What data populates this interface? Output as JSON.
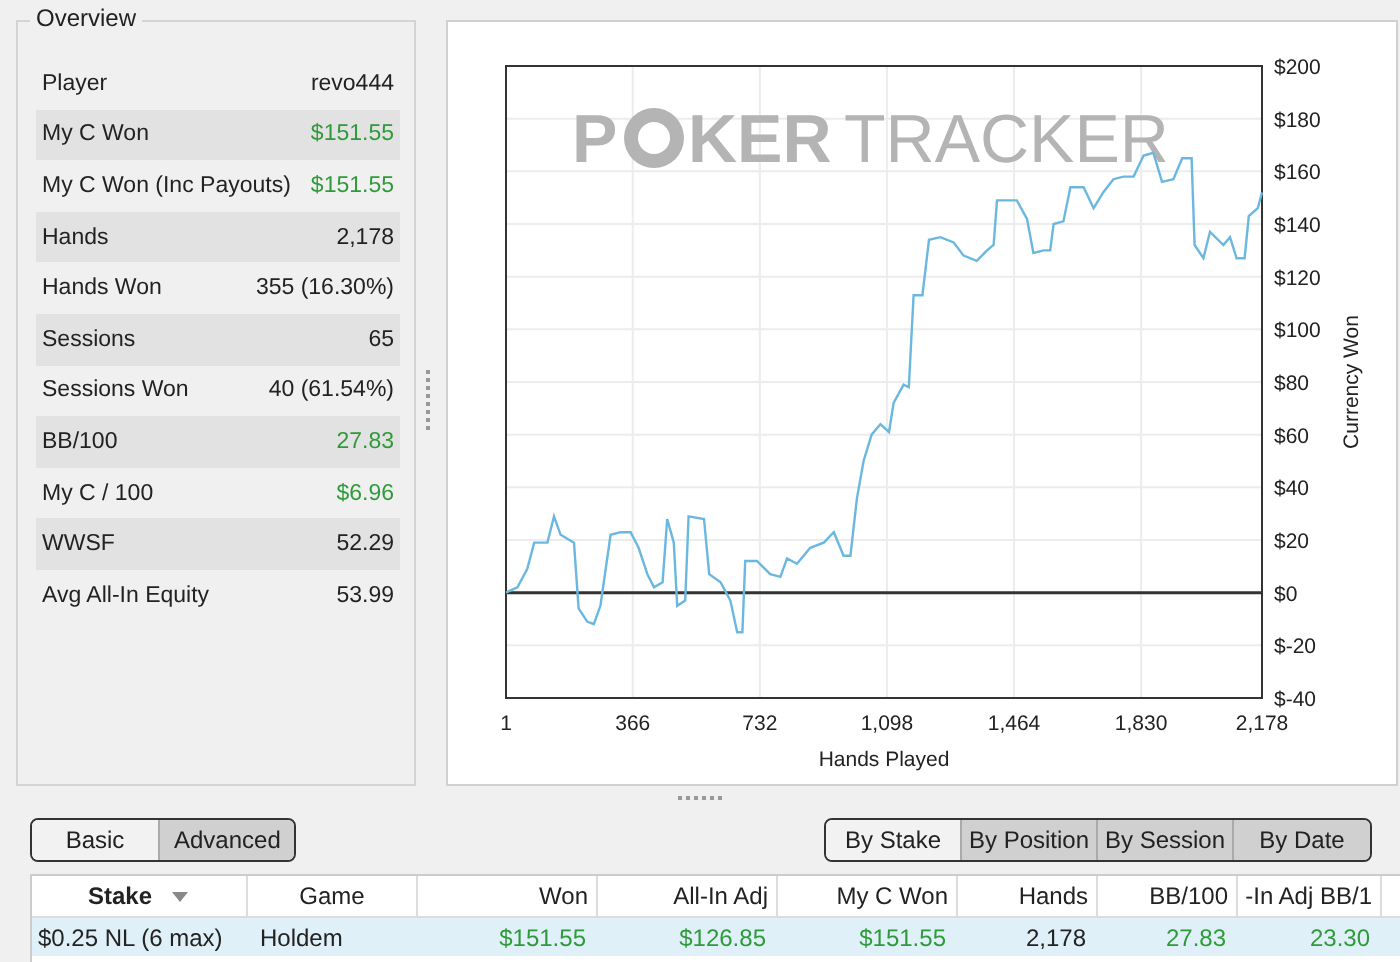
{
  "overview": {
    "title": "Overview",
    "rows": [
      {
        "label": "Player",
        "value": "revo444",
        "kind": "plain"
      },
      {
        "label": "My C Won",
        "value": "$151.55",
        "kind": "gain"
      },
      {
        "label": "My C Won (Inc Payouts)",
        "value": "$151.55",
        "kind": "gain"
      },
      {
        "label": "Hands",
        "value": "2,178",
        "kind": "plain"
      },
      {
        "label": "Hands Won",
        "value": "355 (16.30%)",
        "kind": "plain"
      },
      {
        "label": "Sessions",
        "value": "65",
        "kind": "plain"
      },
      {
        "label": "Sessions Won",
        "value": "40 (61.54%)",
        "kind": "plain"
      },
      {
        "label": "BB/100",
        "value": "27.83",
        "kind": "gain"
      },
      {
        "label": "My C / 100",
        "value": "$6.96",
        "kind": "gain"
      },
      {
        "label": "WWSF",
        "value": "52.29",
        "kind": "plain"
      },
      {
        "label": "Avg All-In Equity",
        "value": "53.99",
        "kind": "plain"
      }
    ]
  },
  "graph": {
    "logo": {
      "first": "P",
      "middle": "KER",
      "last": "TRACKER"
    },
    "chart_data": {
      "type": "line",
      "grid": true,
      "xlabel": "Hands Played",
      "ylabel": "Currency Won",
      "xlim": [
        1,
        2178
      ],
      "ylim": [
        -40,
        200
      ],
      "xticks": [
        {
          "value": 1,
          "label": "1"
        },
        {
          "value": 366,
          "label": "366"
        },
        {
          "value": 732,
          "label": "732"
        },
        {
          "value": 1098,
          "label": "1,098"
        },
        {
          "value": 1464,
          "label": "1,464"
        },
        {
          "value": 1830,
          "label": "1,830"
        },
        {
          "value": 2178,
          "label": "2,178"
        }
      ],
      "yticks": [
        {
          "value": 200,
          "label": "$200"
        },
        {
          "value": 180,
          "label": "$180"
        },
        {
          "value": 160,
          "label": "$160"
        },
        {
          "value": 140,
          "label": "$140"
        },
        {
          "value": 120,
          "label": "$120"
        },
        {
          "value": 100,
          "label": "$100"
        },
        {
          "value": 80,
          "label": "$80"
        },
        {
          "value": 60,
          "label": "$60"
        },
        {
          "value": 40,
          "label": "$40"
        },
        {
          "value": 20,
          "label": "$20"
        },
        {
          "value": 0,
          "label": "$0"
        },
        {
          "value": -20,
          "label": "$-20"
        },
        {
          "value": -40,
          "label": "$-40"
        }
      ],
      "x": [
        1,
        34,
        62,
        82,
        120,
        139,
        158,
        197,
        210,
        235,
        254,
        273,
        302,
        331,
        360,
        383,
        408,
        427,
        452,
        465,
        484,
        494,
        517,
        527,
        571,
        586,
        619,
        647,
        667,
        682,
        690,
        724,
        762,
        791,
        810,
        839,
        877,
        916,
        945,
        973,
        993,
        1012,
        1031,
        1054,
        1079,
        1104,
        1117,
        1146,
        1161,
        1175,
        1200,
        1219,
        1252,
        1290,
        1319,
        1357,
        1386,
        1405,
        1415,
        1472,
        1501,
        1520,
        1549,
        1568,
        1578,
        1606,
        1626,
        1664,
        1693,
        1721,
        1750,
        1779,
        1808,
        1837,
        1865,
        1890,
        1923,
        1948,
        1975,
        1984,
        2009,
        2028,
        2067,
        2086,
        2105,
        2128,
        2140,
        2166,
        2178
      ],
      "series": [
        {
          "color": "#6ab8e0",
          "values": [
            0,
            2,
            9,
            19,
            19,
            29,
            22,
            19,
            -6,
            -11,
            -12,
            -5,
            22,
            23,
            23,
            17,
            7,
            2,
            4,
            28,
            19,
            -5,
            -3,
            29,
            28,
            7,
            4,
            -3,
            -15,
            -15,
            12,
            12,
            7,
            6,
            13,
            11,
            17,
            19,
            23,
            14,
            14,
            36,
            50,
            60,
            64,
            61,
            72,
            79,
            78,
            113,
            113,
            134,
            135,
            133,
            128,
            126,
            130,
            132,
            149,
            149,
            142,
            129,
            130,
            130,
            140,
            141,
            154,
            154,
            146,
            152,
            157,
            158,
            158,
            166,
            167,
            156,
            157,
            165,
            165,
            132,
            127,
            137,
            132,
            135,
            127,
            127,
            143,
            146,
            152
          ]
        }
      ]
    }
  },
  "toolbar": {
    "view_buttons": [
      {
        "label": "Basic",
        "selected": true
      },
      {
        "label": "Advanced",
        "selected": false
      }
    ],
    "group_buttons": [
      {
        "label": "By Stake",
        "selected": true
      },
      {
        "label": "By Position",
        "selected": false
      },
      {
        "label": "By Session",
        "selected": false
      },
      {
        "label": "By Date",
        "selected": false
      }
    ]
  },
  "table": {
    "columns": [
      {
        "label": "Stake",
        "sorted": true
      },
      {
        "label": "Game",
        "sorted": false
      },
      {
        "label": "Won",
        "sorted": false
      },
      {
        "label": "All-In Adj",
        "sorted": false
      },
      {
        "label": "My C Won",
        "sorted": false
      },
      {
        "label": "Hands",
        "sorted": false
      },
      {
        "label": "BB/100",
        "sorted": false
      },
      {
        "label": "-In Adj BB/1",
        "sorted": false
      }
    ],
    "rows": [
      {
        "selected": true,
        "cells": [
          {
            "text": "$0.25 NL (6 max)",
            "kind": "plain"
          },
          {
            "text": "Holdem",
            "kind": "plain"
          },
          {
            "text": "$151.55",
            "kind": "gain"
          },
          {
            "text": "$126.85",
            "kind": "gain"
          },
          {
            "text": "$151.55",
            "kind": "gain"
          },
          {
            "text": "2,178",
            "kind": "plain"
          },
          {
            "text": "27.83",
            "kind": "gain"
          },
          {
            "text": "23.30",
            "kind": "gain"
          }
        ]
      }
    ]
  }
}
